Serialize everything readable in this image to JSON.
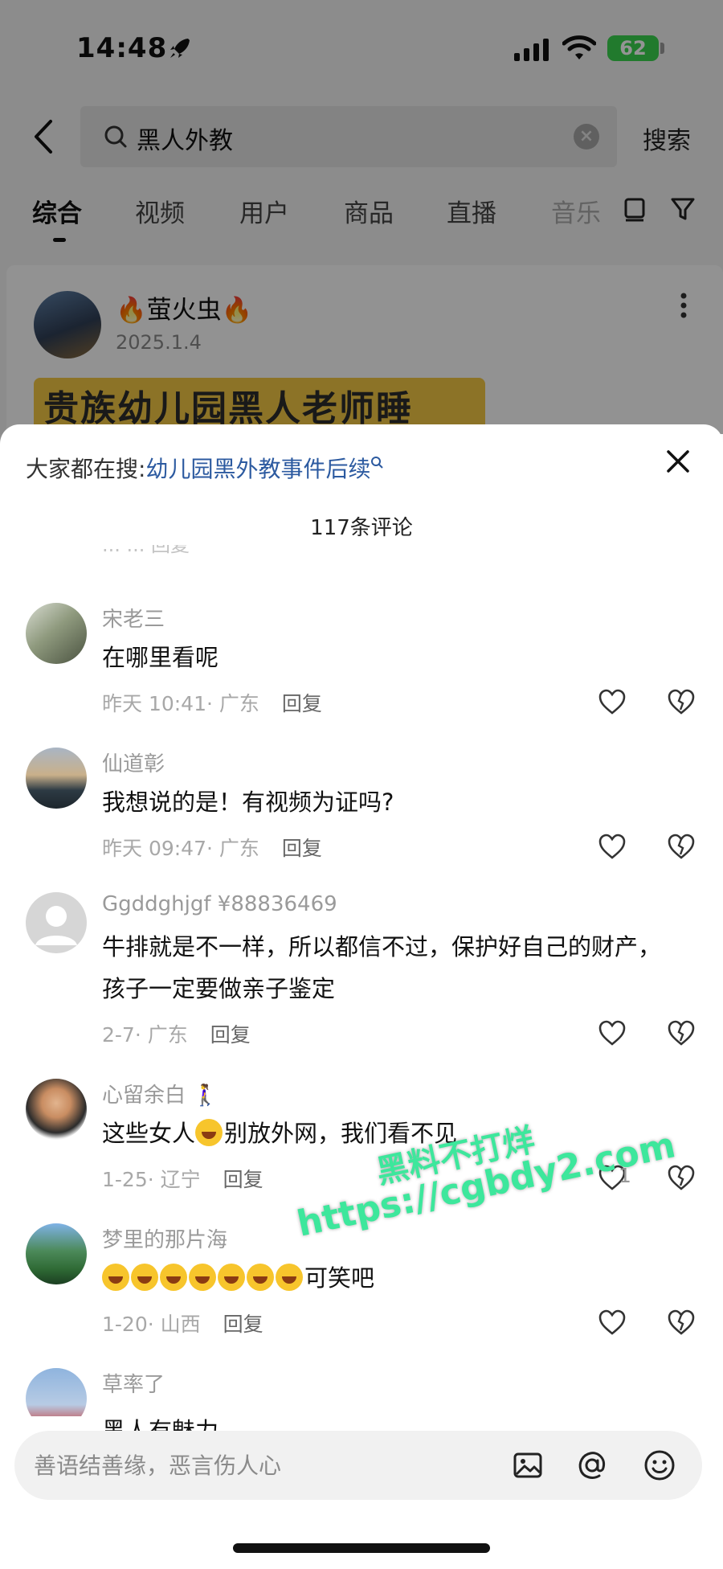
{
  "status_bar": {
    "time": "14:48",
    "battery": "62"
  },
  "search": {
    "query": "黑人外教",
    "button": "搜索"
  },
  "tabs": [
    {
      "label": "综合"
    },
    {
      "label": "视频"
    },
    {
      "label": "用户"
    },
    {
      "label": "商品"
    },
    {
      "label": "直播"
    },
    {
      "label": "音乐"
    }
  ],
  "post": {
    "author": "🔥萤火虫🔥",
    "date": "2025.1.4",
    "thumbnail_caption": "贵族幼儿园黑人老师睡"
  },
  "sheet": {
    "hot_search_prefix": "大家都在搜:",
    "hot_search_link": "幼儿园黑外教事件后续",
    "comment_count": "117条评论",
    "clipped_meta": "...  ...  回复"
  },
  "comments": [
    {
      "user": "宋老三",
      "text": "在哪里看呢",
      "time": "昨天 10:41",
      "location": "广东",
      "reply": "回复",
      "likes": ""
    },
    {
      "user": "仙道彰",
      "text": "我想说的是！有视频为证吗?",
      "time": "昨天 09:47",
      "location": "广东",
      "reply": "回复",
      "likes": ""
    },
    {
      "user": "Ggddghjgf ¥88836469",
      "text": "牛排就是不一样，所以都信不过，保护好自己的财产，孩子一定要做亲子鉴定",
      "time": "2-7",
      "location": "广东",
      "reply": "回复",
      "likes": ""
    },
    {
      "user": "心留余白 🚶‍♀️",
      "text_before": "这些女人",
      "text_after": "别放外网，我们看不见",
      "time": "1-25",
      "location": "辽宁",
      "reply": "回复",
      "likes": "1"
    },
    {
      "user": "梦里的那片海",
      "text_after": "可笑吧",
      "emoji_count": 7,
      "time": "1-20",
      "location": "山西",
      "reply": "回复",
      "likes": ""
    },
    {
      "user": "草率了",
      "text": "黑人有魅力"
    }
  ],
  "watermark": {
    "line1": "黑料不打烊",
    "line2": "https://cgbdy2.com"
  },
  "input": {
    "placeholder": "善语结善缘，恶言伤人心"
  },
  "colors": {
    "link": "#2c5aa0",
    "battery": "#3ad34f",
    "watermark": "#3de79c"
  }
}
